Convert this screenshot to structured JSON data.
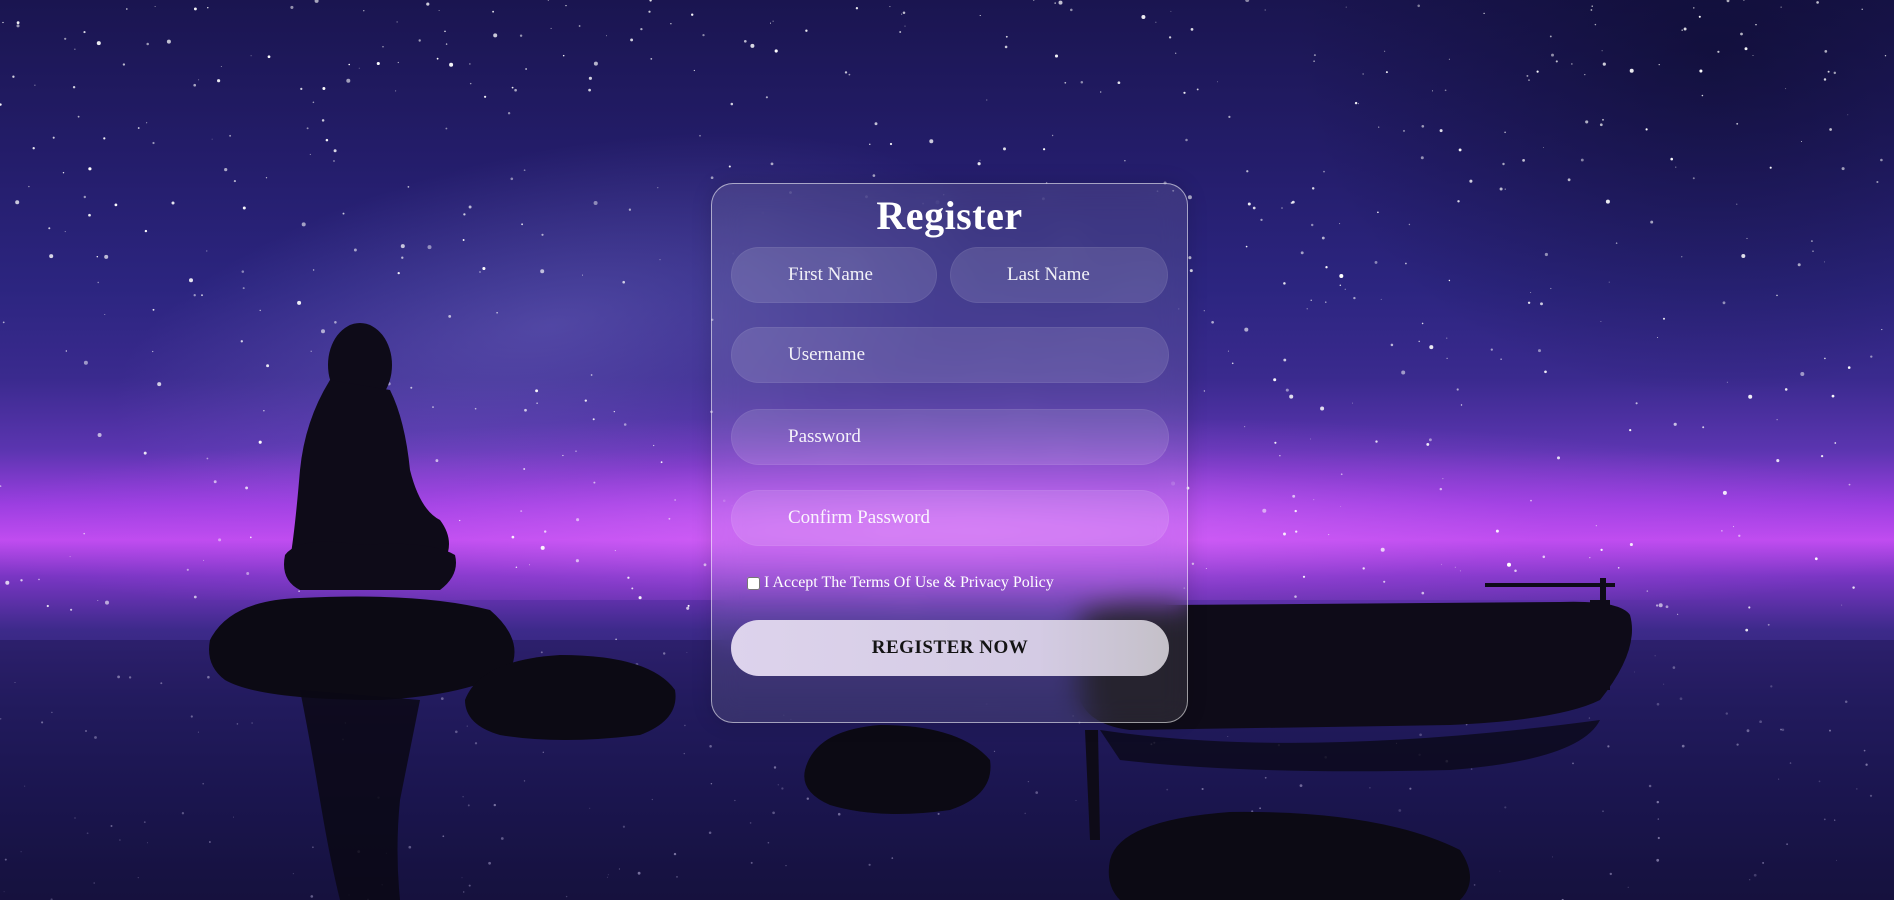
{
  "form": {
    "title": "Register",
    "first_name_placeholder": "First Name",
    "last_name_placeholder": "Last Name",
    "username_placeholder": "Username",
    "password_placeholder": "Password",
    "confirm_password_placeholder": "Confirm Password",
    "terms_label": "I Accept The Terms Of Use & Privacy Policy",
    "terms_checked": false,
    "submit_label": "REGISTER NOW"
  },
  "theme": {
    "text_color": "#ffffff",
    "button_text_color": "#141414",
    "horizon_glow": "#c04cf0"
  }
}
